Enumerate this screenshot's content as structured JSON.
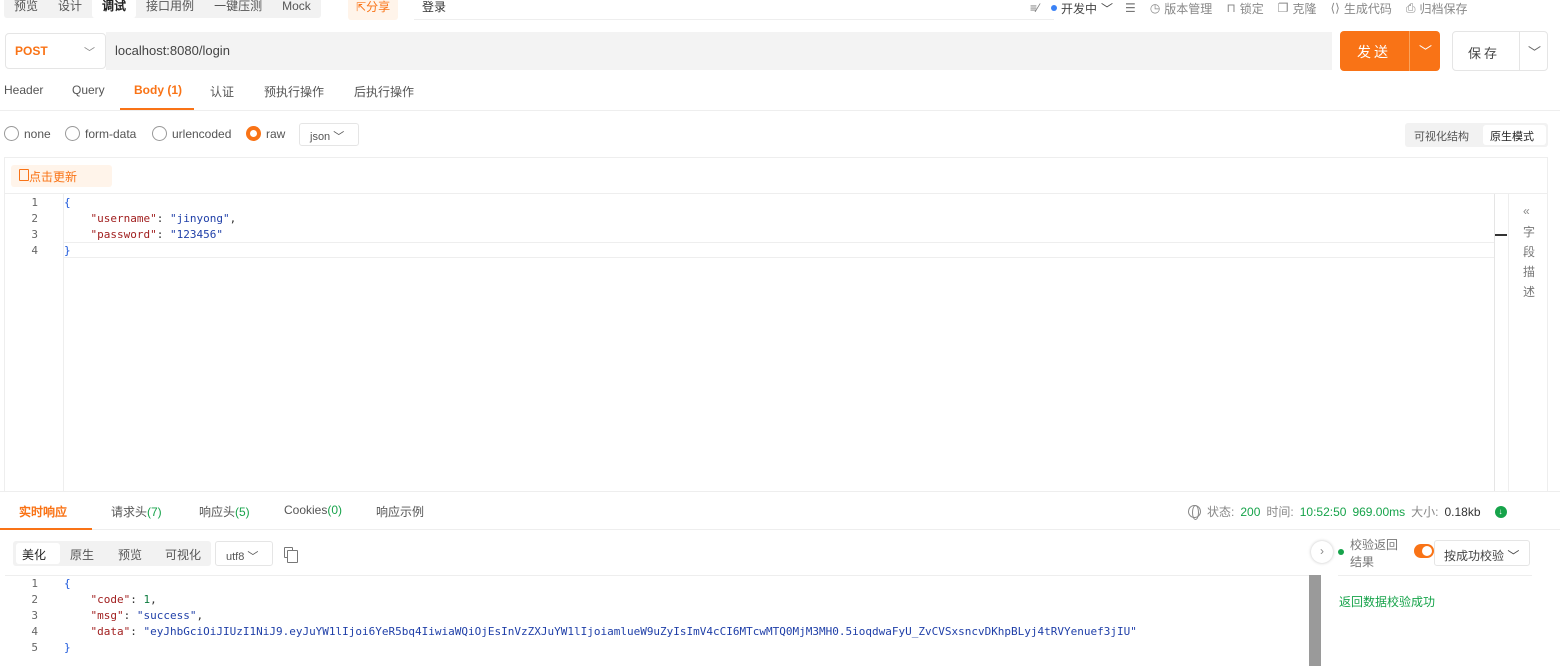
{
  "topbar": {
    "mode_tabs": [
      "预览",
      "设计",
      "调试",
      "接口用例",
      "一键压测",
      "Mock"
    ],
    "active_mode": "调试",
    "share_label": "分享",
    "api_name": "登录",
    "status_label": "开发中",
    "tools": [
      "版本管理",
      "锁定",
      "克隆",
      "生成代码",
      "归档保存"
    ]
  },
  "request": {
    "method": "POST",
    "url": "localhost:8080/login",
    "send_label": "发送",
    "save_label": "保存"
  },
  "request_tabs": {
    "header": "Header",
    "query": "Query",
    "body": "Body (1)",
    "auth": "认证",
    "pre": "预执行操作",
    "post": "后执行操作"
  },
  "body_types": {
    "none": "none",
    "form_data": "form-data",
    "urlencoded": "urlencoded",
    "raw": "raw",
    "selected": "raw",
    "format": "json"
  },
  "view_modes": {
    "visual": "可视化结构",
    "raw": "原生模式",
    "selected": "原生模式"
  },
  "editor": {
    "update_label": "点击更新",
    "field_desc_label": "字段描述",
    "line_numbers": [
      "1",
      "2",
      "3",
      "4"
    ],
    "body": {
      "open": "{",
      "username_key": "\"username\"",
      "username_val": "\"jinyong\"",
      "password_key": "\"password\"",
      "password_val": "\"123456\"",
      "close": "}"
    }
  },
  "response_tabs": {
    "live": "实时响应",
    "req_headers": "请求头",
    "req_headers_count": "(7)",
    "resp_headers": "响应头",
    "resp_headers_count": "(5)",
    "cookies": "Cookies",
    "cookies_count": "(0)",
    "example": "响应示例"
  },
  "response_meta": {
    "status_label": "状态:",
    "status_value": "200",
    "time_label": "时间:",
    "time_value": "10:52:50",
    "duration": "969.00ms",
    "size_label": "大小:",
    "size_value": "0.18kb"
  },
  "response_view": {
    "tabs": [
      "美化",
      "原生",
      "预览",
      "可视化"
    ],
    "active": "美化",
    "encoding": "utf8"
  },
  "response_body": {
    "line_numbers": [
      "1",
      "2",
      "3",
      "4",
      "5"
    ],
    "open": "{",
    "code_key": "\"code\"",
    "code_val": "1",
    "msg_key": "\"msg\"",
    "msg_val": "\"success\"",
    "data_key": "\"data\"",
    "data_val": "\"eyJhbGciOiJIUzI1NiJ9.eyJuYW1lIjoi6YeR5bq4IiwiaWQiOjEsInVzZXJuYW1lIjoiamlueW9uZyIsImV4cCI6MTcwMTQ0MjM3MH0.5ioqdwaFyU_ZvCVSxsncvDKhpBLyj4tRVYenuef3jIU\"",
    "close": "}"
  },
  "validation": {
    "title": "校验返回结果",
    "rule": "按成功校验",
    "enabled": true,
    "message": "返回数据校验成功"
  },
  "colors": {
    "accent": "#f97316",
    "success": "#16a34a",
    "status_dot": "#3b82f6"
  }
}
